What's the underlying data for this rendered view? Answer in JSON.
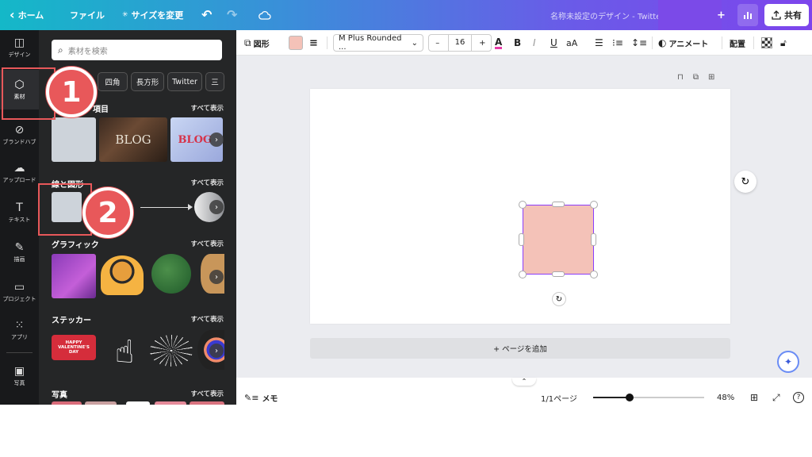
{
  "topbar": {
    "back_label": "ホーム",
    "file_label": "ファイル",
    "resize_label": "サイズを変更",
    "title": "名称未設定のデザイン - Twitter",
    "share_label": "共有"
  },
  "rail": {
    "items": [
      {
        "label": "デザイン",
        "icon": "layout-icon"
      },
      {
        "label": "素材",
        "icon": "elements-icon"
      },
      {
        "label": "ブランドハブ",
        "icon": "brand-icon"
      },
      {
        "label": "アップロード",
        "icon": "upload-icon"
      },
      {
        "label": "テキスト",
        "icon": "text-icon"
      },
      {
        "label": "描画",
        "icon": "draw-icon"
      },
      {
        "label": "プロジェクト",
        "icon": "folder-icon"
      },
      {
        "label": "アプリ",
        "icon": "apps-icon"
      },
      {
        "label": "写真",
        "icon": "photo-icon"
      }
    ]
  },
  "panel": {
    "search_placeholder": "素材を検索",
    "chips": [
      "四角",
      "長方形",
      "Twitter",
      "三"
    ],
    "sections": {
      "recent": {
        "title": "項目",
        "more": "すべて表示"
      },
      "shapes": {
        "title": "線と図形",
        "more": "すべて表示"
      },
      "graphics": {
        "title": "グラフィック",
        "more": "すべて表示"
      },
      "stickers": {
        "title": "ステッカー",
        "more": "すべて表示"
      },
      "photos": {
        "title": "写真",
        "more": "すべて表示"
      }
    },
    "blog_text": "BLOG",
    "sticker_text": "HAPPY VALENTINE'S DAY"
  },
  "toolbar": {
    "shape_label": "図形",
    "fill_color": "#f4c2b8",
    "font_name": "M Plus Rounded ...",
    "font_size": "16",
    "minus": "–",
    "plus": "+",
    "bold": "B",
    "italic": "I",
    "underline": "U",
    "case": "aA",
    "animate_label": "アニメート",
    "position_label": "配置"
  },
  "canvas": {
    "add_page_label": "+ ページを追加",
    "shape_color": "#f4c2b8",
    "selection_color": "#8b3dff"
  },
  "statusbar": {
    "notes_label": "メモ",
    "page_indicator": "1/1ページ",
    "zoom_label": "48%"
  },
  "callouts": [
    {
      "number": "1"
    },
    {
      "number": "2"
    }
  ],
  "colors": {
    "accent": "#8b3dff",
    "callout": "#e8585a",
    "panel_bg": "#252627",
    "rail_bg": "#18191b"
  }
}
